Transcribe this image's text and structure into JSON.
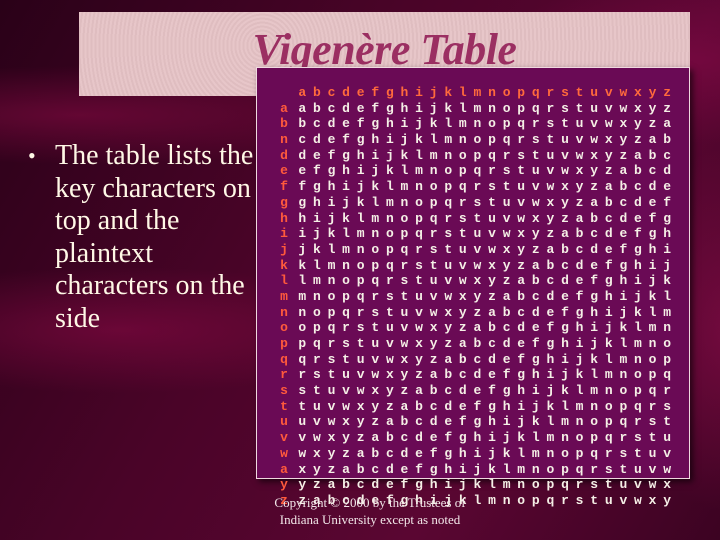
{
  "slide": {
    "title": "Vigenère Table",
    "bullet_symbol": "•",
    "bullet_text": "The table lists the key characters on top and the plaintext characters on the side",
    "footer_line1": "Copyright © 2000 by  the Trustees of",
    "footer_line2": "Indiana University except as noted"
  },
  "colors": {
    "title": "#9b2f62",
    "title_box": "#e6c3c6",
    "table_background": "#6a0a55",
    "header_letters": "#ff6a3c",
    "side_letters": "#ff5a3c",
    "cell_letters": "#f5efe6",
    "bullet_text": "#fff8e6"
  },
  "vigenere": {
    "header": [
      "a",
      "b",
      "c",
      "d",
      "e",
      "f",
      "g",
      "h",
      "i",
      "j",
      "k",
      "l",
      "m",
      "n",
      "o",
      "p",
      "q",
      "r",
      "s",
      "t",
      "u",
      "v",
      "w",
      "x",
      "y",
      "z"
    ],
    "side_labels": [
      "a",
      "b",
      "n",
      "d",
      "e",
      "f",
      "g",
      "h",
      "i",
      "j",
      "k",
      "l",
      "m",
      "n",
      "o",
      "p",
      "q",
      "r",
      "s",
      "t",
      "u",
      "v",
      "w",
      "a",
      "y",
      "z"
    ],
    "rows": [
      "abcdefghijklmnopqrstuvwxyz",
      "bcdefghijklmnopqrstuvwxyza",
      "cdefghijklmnopqrstuvwxyzab",
      "defghijklmnopqrstuvwxyzabc",
      "efghijklmnopqrstuvwxyzabcd",
      "fghijklmnopqrstuvwxyzabcde",
      "ghijklmnopqrstuvwxyzabcdef",
      "hijklmnopqrstuvwxyzabcdefg",
      "ijklmnopqrstuvwxyzabcdefgh",
      "jklmnopqrstuvwxyzabcdefghi",
      "klmnopqrstuvwxyzabcdefghij",
      "lmnopqrstuvwxyzabcdefghijk",
      "mnopqrstuvwxyzabcdefghijkl",
      "nopqrstuvwxyzabcdefghijklm",
      "opqrstuvwxyzabcdefghijklmn",
      "pqrstuvwxyzabcdefghijklmno",
      "qrstuvwxyzabcdefghijklmnop",
      "rstuvwxyzabcdefghijklmnopq",
      "stuvwxyzabcdefghijklmnopqr",
      "tuvwxyzabcdefghijklmnopqrs",
      "uvwxyzabcdefghijklmnopqrst",
      "vwxyzabcdefghijklmnopqrstu",
      "wxyzabcdefghijklmnopqrstuv",
      "xyzabcdefghijklmnopqrstuvw",
      "yzabcdefghijklmnopqrstuvwx",
      "zabcdefghijklmnopqrstuvwxy"
    ]
  }
}
